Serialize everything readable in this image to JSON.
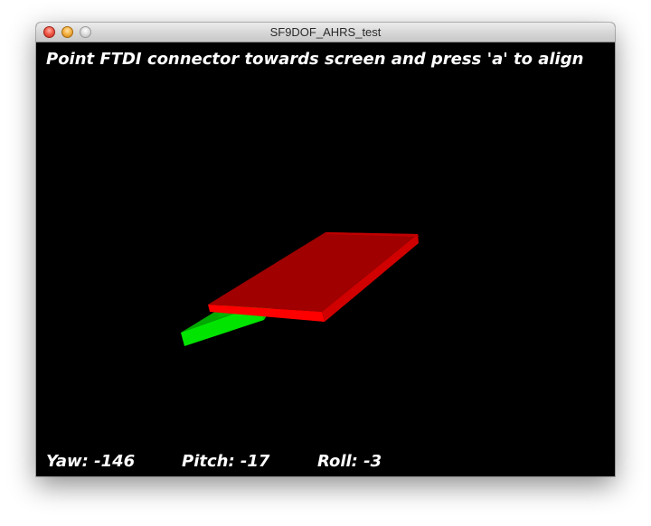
{
  "window": {
    "title": "SF9DOF_AHRS_test"
  },
  "instruction": {
    "text": "Point FTDI connector towards screen and press 'a' to align"
  },
  "readouts": {
    "yaw": "Yaw: -146",
    "pitch": "Pitch: -17",
    "roll": "Roll: -3"
  },
  "orientation": {
    "yaw_deg": -146,
    "pitch_deg": -17,
    "roll_deg": -3
  },
  "scene": {
    "board_color": "#d40000",
    "connector_color": "#00d000",
    "background": "#000000"
  }
}
